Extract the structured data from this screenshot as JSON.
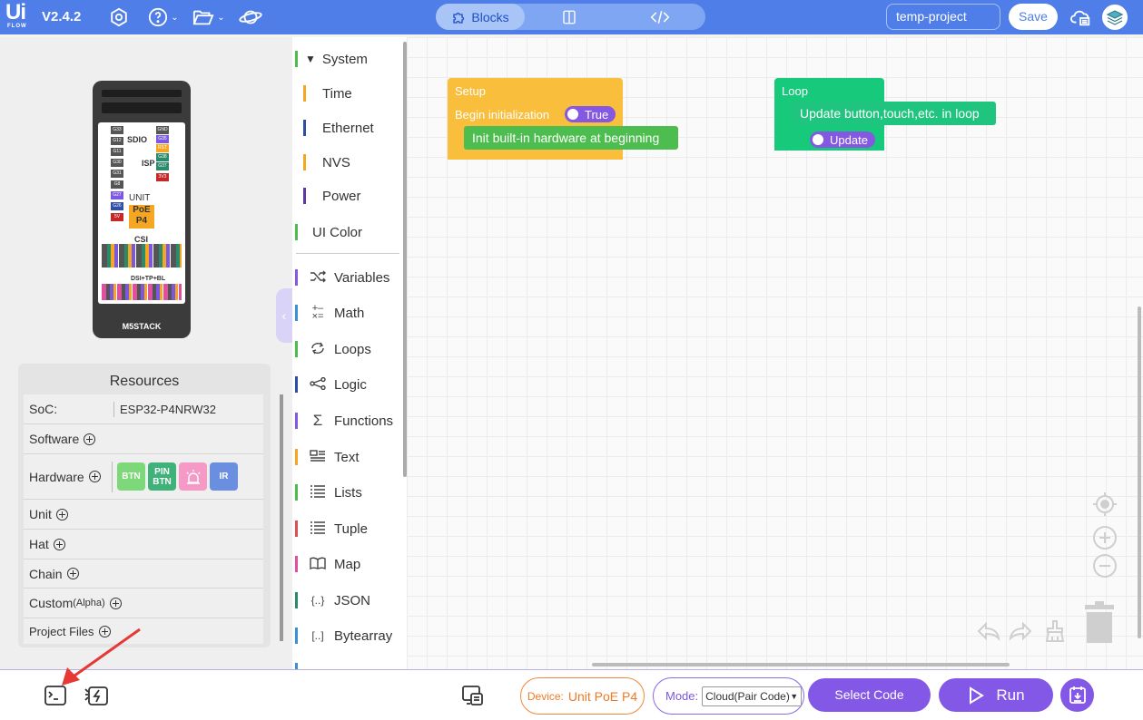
{
  "app": {
    "logo_top": "Ui",
    "logo_bottom": "FLOW",
    "version": "V2.4.2"
  },
  "toolbar": {
    "icons": [
      "settings-icon",
      "help-icon",
      "folder-icon",
      "planet-icon"
    ],
    "view_tabs": [
      {
        "label": "Blocks",
        "icon": "puzzle-icon",
        "active": true
      },
      {
        "label": "",
        "icon": "split-view-icon",
        "active": false
      },
      {
        "label": "",
        "icon": "code-icon",
        "active": false
      }
    ],
    "project_name": "temp-project",
    "save_label": "Save",
    "right_icons": [
      "cloud-upload-icon",
      "stack-avatar-icon"
    ]
  },
  "device_image": {
    "label": "M5STACK",
    "text_unit": "UNIT",
    "text_model": "PoE\nP4",
    "text_sdio": "SDIO",
    "text_isp": "ISP",
    "text_csi": "CSI",
    "text_dsi": "DSI+TP+BL"
  },
  "resources": {
    "title": "Resources",
    "soc_label": "SoC:",
    "soc_value": "ESP32-P4NRW32",
    "software": "Software",
    "hardware": "Hardware",
    "hardware_chips": [
      {
        "label": "BTN",
        "color": "#7dd87a"
      },
      {
        "label": "PIN\nBTN",
        "color": "#3fb27a"
      },
      {
        "label": "",
        "color": "#f59ac7"
      },
      {
        "label": "IR",
        "color": "#6a8fe0"
      }
    ],
    "unit": "Unit",
    "hat": "Hat",
    "chain": "Chain",
    "custom": "Custom",
    "custom_suffix": "(Alpha)",
    "project_files": "Project Files"
  },
  "categories": [
    {
      "label": "System",
      "color": "#4dbd4f",
      "icon": "triangle-down-icon"
    },
    {
      "label": "Time",
      "color": "#f5a623",
      "icon": ""
    },
    {
      "label": "Ethernet",
      "color": "#2d4fa5",
      "icon": ""
    },
    {
      "label": "NVS",
      "color": "#f5a623",
      "icon": ""
    },
    {
      "label": "Power",
      "color": "#5b3aa8",
      "icon": ""
    },
    {
      "label": "UI Color",
      "color": "#4dbd4f",
      "icon": ""
    },
    {
      "label": "Variables",
      "color": "#8458e0",
      "icon": "shuffle-icon"
    },
    {
      "label": "Math",
      "color": "#3d8fd6",
      "icon": "math-icon"
    },
    {
      "label": "Loops",
      "color": "#4dbd4f",
      "icon": "loop-icon"
    },
    {
      "label": "Logic",
      "color": "#2d4fa5",
      "icon": "logic-icon"
    },
    {
      "label": "Functions",
      "color": "#8458e0",
      "icon": "sigma-icon"
    },
    {
      "label": "Text",
      "color": "#f5a623",
      "icon": "text-icon"
    },
    {
      "label": "Lists",
      "color": "#4dbd4f",
      "icon": "list-icon"
    },
    {
      "label": "Tuple",
      "color": "#e04f4f",
      "icon": "list-icon"
    },
    {
      "label": "Map",
      "color": "#e04fa0",
      "icon": "book-icon"
    },
    {
      "label": "JSON",
      "color": "#2a8a6a",
      "icon": "json-icon"
    },
    {
      "label": "Bytearray",
      "color": "#3d8fd6",
      "icon": "bytearray-icon"
    }
  ],
  "workspace": {
    "setup": {
      "title": "Setup",
      "line": "Begin initialization",
      "toggle": "True",
      "statement": "Init built-in hardware at beginning"
    },
    "loop": {
      "title": "Loop",
      "statement": "Update button,touch,etc. in loop",
      "toggle": "Update"
    }
  },
  "bottombar": {
    "device_label": "Device:",
    "device_value": "Unit PoE P4",
    "mode_label": "Mode:",
    "mode_value": "Cloud(Pair Code)",
    "select_code": "Select Code",
    "run": "Run"
  },
  "colors": {
    "topbar": "#4f7ee8",
    "accent": "#8458e6",
    "setup_block": "#f9be3c",
    "loop_block": "#17c97b",
    "arrow": "#e53935"
  }
}
